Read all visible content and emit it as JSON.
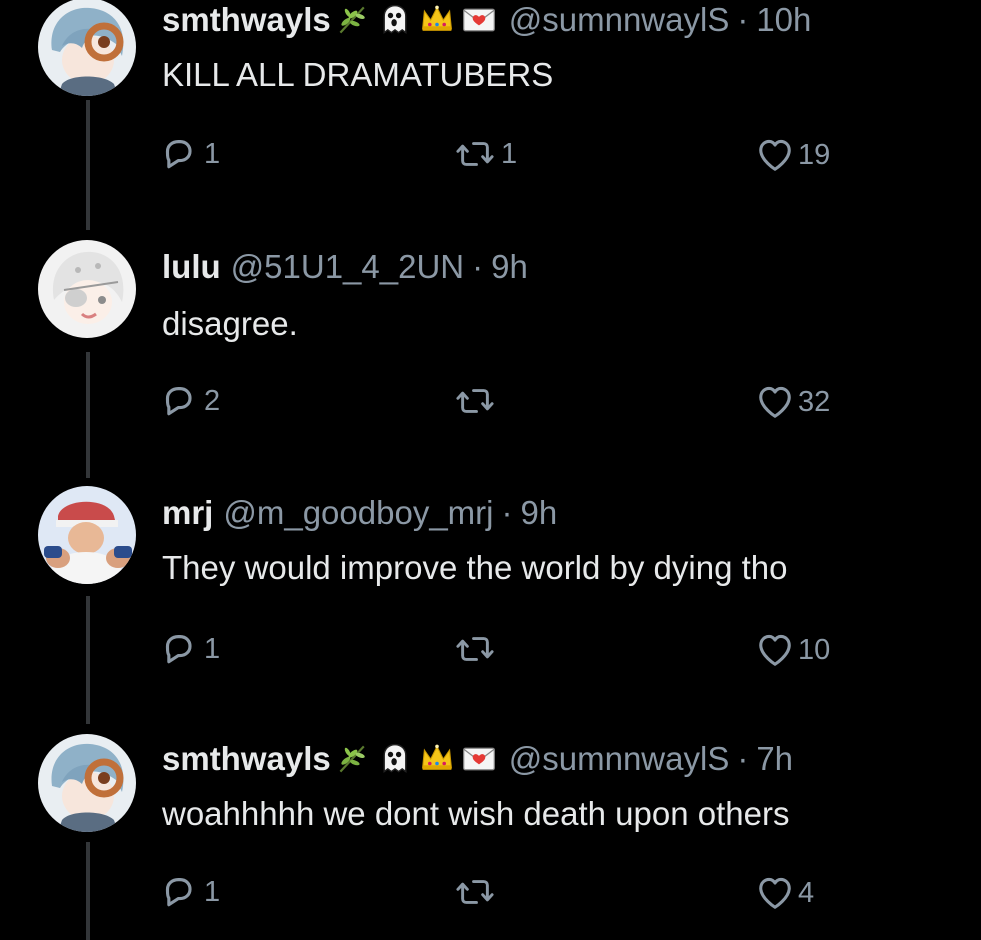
{
  "tweets": [
    {
      "name": "smthwayls",
      "handle": "@sumnnwaylS",
      "separator": "·",
      "time": "10h",
      "text": "KILL ALL DRAMATUBERS",
      "replies": "1",
      "retweets": "1",
      "likes": "19"
    },
    {
      "name": "lulu",
      "handle": "@51U1_4_2UN",
      "separator": "·",
      "time": "9h",
      "text": "disagree.",
      "replies": "2",
      "retweets": "",
      "likes": "32"
    },
    {
      "name": "mrj",
      "handle": "@m_goodboy_mrj",
      "separator": "·",
      "time": "9h",
      "text": "They would improve the world by dying tho",
      "replies": "1",
      "retweets": "",
      "likes": "10"
    },
    {
      "name": "smthwayls",
      "handle": "@sumnnwaylS",
      "separator": "·",
      "time": "7h",
      "text": "woahhhhh we dont wish death upon others",
      "replies": "1",
      "retweets": "",
      "likes": "4"
    }
  ],
  "colors": {
    "background": "#000000",
    "text": "#e7e9ea",
    "secondary": "#8b98a5",
    "thread_line": "#333639"
  },
  "icons": {
    "reply": "reply-icon",
    "retweet": "retweet-icon",
    "like": "heart-icon",
    "name_emojis": [
      "herb-emoji",
      "ghost-emoji",
      "crown-emoji",
      "love-letter-emoji"
    ]
  }
}
